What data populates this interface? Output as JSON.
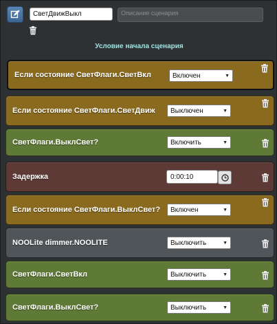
{
  "header": {
    "name_value": "СветДвижВыкл",
    "description_placeholder": "Описание сценария",
    "section_title": "Условие начала сценария"
  },
  "colors": {
    "condition": "#8a6a1f",
    "action": "#5e7a36",
    "delay": "#5e3a36",
    "device": "#4f5558"
  },
  "icons": {
    "edit": "pencil-edit-icon",
    "delete": "trash-icon",
    "select": "caret-down-icon",
    "timer": "clock-icon"
  },
  "blocks": [
    {
      "kind": "condition",
      "label": "Если состояние СветФлаги.СветВкл",
      "value": "Включен"
    },
    {
      "kind": "condition",
      "label": "Если состояние СветФлаги.СветДвиж",
      "value": "Выключен"
    },
    {
      "kind": "action",
      "label": "СветФлаги.ВыклСвет?",
      "value": "Включить"
    },
    {
      "kind": "delay",
      "label": "Задержка",
      "value": "0:00:10"
    },
    {
      "kind": "condition",
      "label": "Если состояние СветФлаги.ВыклСвет?",
      "value": "Включен"
    },
    {
      "kind": "device",
      "label": "NOOLite dimmer.NOOLITE",
      "value": "Выключить"
    },
    {
      "kind": "action",
      "label": "СветФлаги.СветВкл",
      "value": "Выключить"
    },
    {
      "kind": "action",
      "label": "СветФлаги.ВыклСвет?",
      "value": "Выключить"
    }
  ]
}
